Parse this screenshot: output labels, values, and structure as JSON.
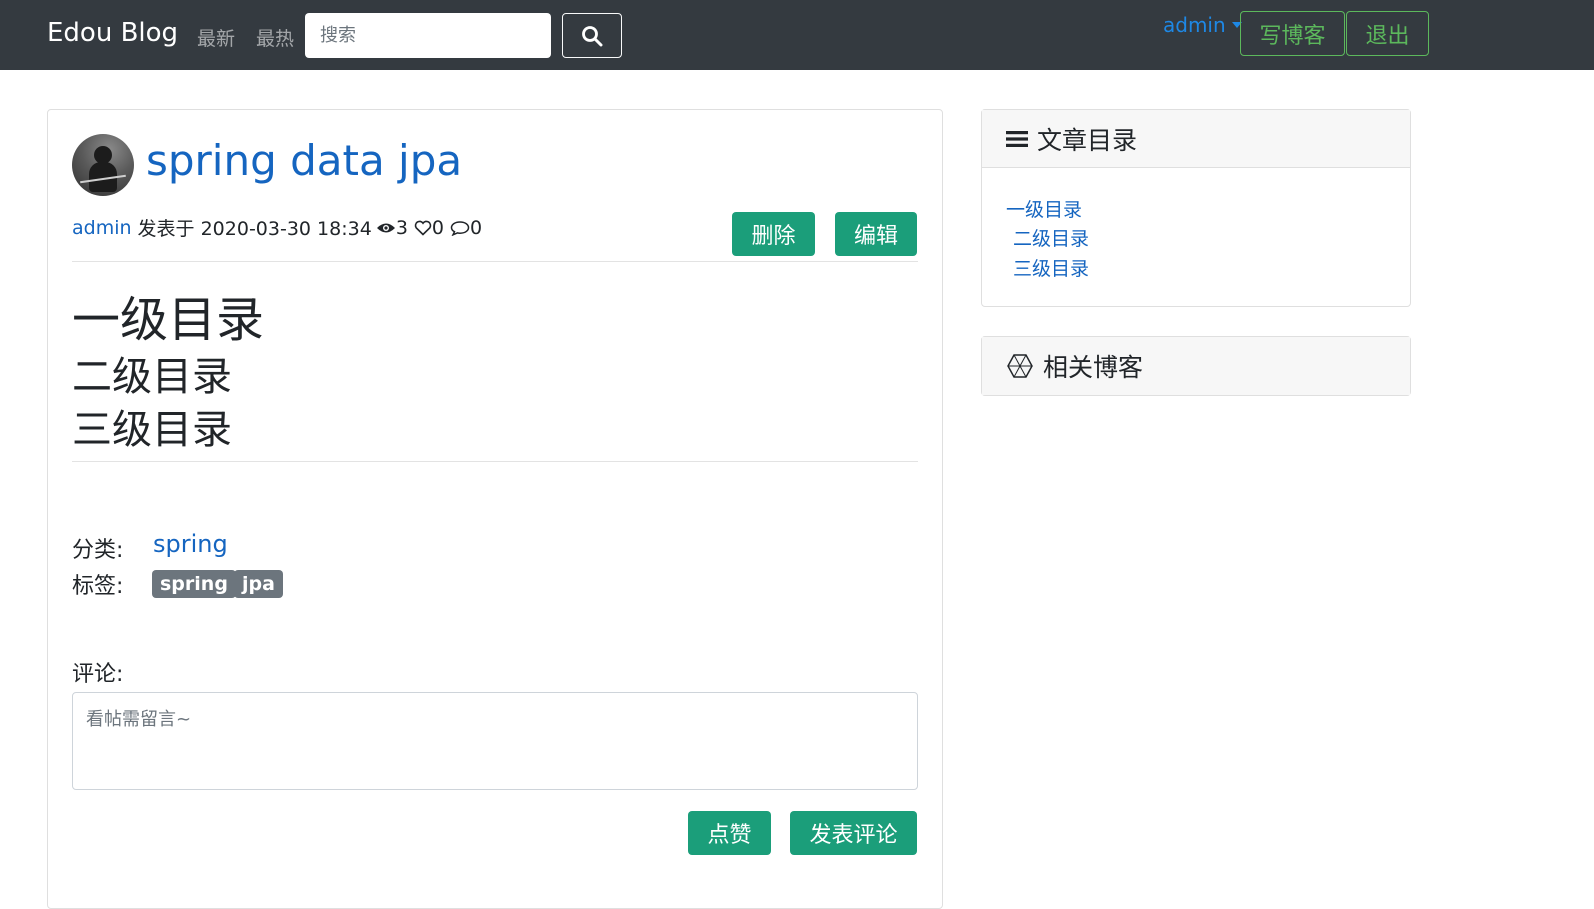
{
  "navbar": {
    "brand": "Edou Blog",
    "links": [
      "最新",
      "最热"
    ],
    "search_placeholder": "搜索",
    "user": "admin",
    "write_button": "写博客",
    "logout_button": "退出"
  },
  "post": {
    "title": "spring data jpa",
    "author": "admin",
    "published_text": "发表于 2020-03-30 18:34",
    "views": "3",
    "likes": "0",
    "comments": "0",
    "delete_button": "删除",
    "edit_button": "编辑",
    "headings": [
      "一级目录",
      "二级目录",
      "三级目录"
    ],
    "category_label": "分类:",
    "category": "spring",
    "tags_label": "标签:",
    "tags": [
      "spring",
      "jpa"
    ],
    "comment_label": "评论:",
    "comment_placeholder": "看帖需留言~",
    "like_button": "点赞",
    "submit_comment_button": "发表评论"
  },
  "sidebar": {
    "toc_title": "文章目录",
    "toc_items": [
      "一级目录",
      "二级目录",
      "三级目录"
    ],
    "related_title": "相关博客"
  },
  "colors": {
    "navbar_bg": "#343a40",
    "link_blue": "#1565c0",
    "success_green": "#1b9e7a",
    "outline_green": "#5cb85c",
    "tag_gray": "#6c757d"
  }
}
